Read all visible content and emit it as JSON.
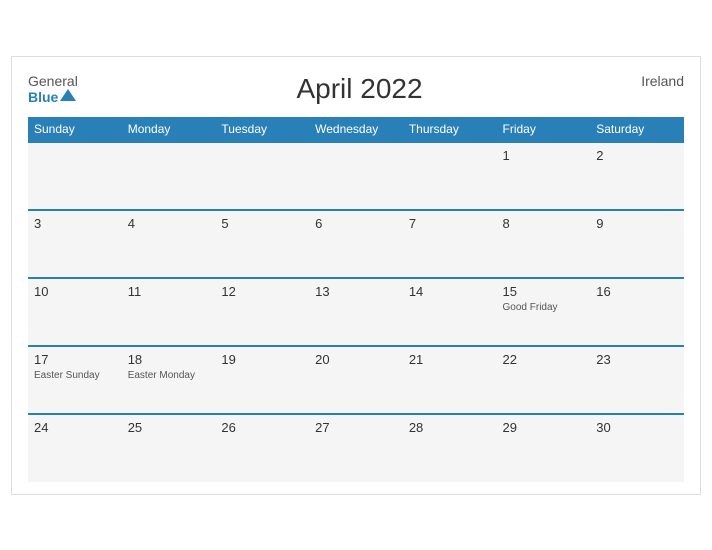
{
  "header": {
    "logo": {
      "general": "General",
      "blue": "Blue",
      "triangle": "▲"
    },
    "title": "April 2022",
    "country": "Ireland"
  },
  "weekdays": [
    "Sunday",
    "Monday",
    "Tuesday",
    "Wednesday",
    "Thursday",
    "Friday",
    "Saturday"
  ],
  "weeks": [
    [
      {
        "day": "",
        "holiday": ""
      },
      {
        "day": "",
        "holiday": ""
      },
      {
        "day": "",
        "holiday": ""
      },
      {
        "day": "",
        "holiday": ""
      },
      {
        "day": "",
        "holiday": ""
      },
      {
        "day": "1",
        "holiday": ""
      },
      {
        "day": "2",
        "holiday": ""
      }
    ],
    [
      {
        "day": "3",
        "holiday": ""
      },
      {
        "day": "4",
        "holiday": ""
      },
      {
        "day": "5",
        "holiday": ""
      },
      {
        "day": "6",
        "holiday": ""
      },
      {
        "day": "7",
        "holiday": ""
      },
      {
        "day": "8",
        "holiday": ""
      },
      {
        "day": "9",
        "holiday": ""
      }
    ],
    [
      {
        "day": "10",
        "holiday": ""
      },
      {
        "day": "11",
        "holiday": ""
      },
      {
        "day": "12",
        "holiday": ""
      },
      {
        "day": "13",
        "holiday": ""
      },
      {
        "day": "14",
        "holiday": ""
      },
      {
        "day": "15",
        "holiday": "Good Friday"
      },
      {
        "day": "16",
        "holiday": ""
      }
    ],
    [
      {
        "day": "17",
        "holiday": "Easter Sunday"
      },
      {
        "day": "18",
        "holiday": "Easter Monday"
      },
      {
        "day": "19",
        "holiday": ""
      },
      {
        "day": "20",
        "holiday": ""
      },
      {
        "day": "21",
        "holiday": ""
      },
      {
        "day": "22",
        "holiday": ""
      },
      {
        "day": "23",
        "holiday": ""
      }
    ],
    [
      {
        "day": "24",
        "holiday": ""
      },
      {
        "day": "25",
        "holiday": ""
      },
      {
        "day": "26",
        "holiday": ""
      },
      {
        "day": "27",
        "holiday": ""
      },
      {
        "day": "28",
        "holiday": ""
      },
      {
        "day": "29",
        "holiday": ""
      },
      {
        "day": "30",
        "holiday": ""
      }
    ]
  ]
}
